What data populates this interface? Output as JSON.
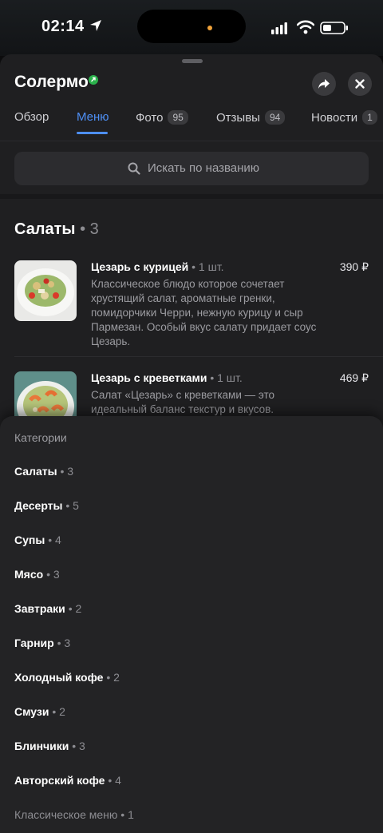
{
  "status_bar": {
    "time": "02:14"
  },
  "place": {
    "title": "Солермо",
    "verified_color": "#2bb24c",
    "accent_color": "#4e8ff5"
  },
  "tabs": [
    {
      "label": "Обзор",
      "badge": null
    },
    {
      "label": "Меню",
      "badge": null,
      "active": true
    },
    {
      "label": "Фото",
      "badge": "95"
    },
    {
      "label": "Отзывы",
      "badge": "94"
    },
    {
      "label": "Новости",
      "badge": "1"
    }
  ],
  "search": {
    "placeholder": "Искать по названию"
  },
  "section": {
    "title": "Салаты",
    "count": "• 3"
  },
  "menu_items": [
    {
      "name": "Цезарь с курицей",
      "qty": "• 1 шт.",
      "price": "390 ₽",
      "description": "Классическое блюдо которое сочетает хрустящий салат, ароматные гренки, помидорчики Черри, нежную курицу и сыр Пармезан. Особый вкус салату придает соус Цезарь."
    },
    {
      "name": "Цезарь с креветками",
      "qty": "• 1 шт.",
      "price": "469 ₽",
      "description": "Салат «Цезарь» с креветками — это идеальный баланс текстур и вкусов."
    }
  ],
  "categories": {
    "header": "Категории",
    "items": [
      {
        "label": "Салаты",
        "count": "• 3"
      },
      {
        "label": "Десерты",
        "count": "• 5"
      },
      {
        "label": "Супы",
        "count": "• 4"
      },
      {
        "label": "Мясо",
        "count": "• 3"
      },
      {
        "label": "Завтраки",
        "count": "• 2"
      },
      {
        "label": "Гарнир",
        "count": "• 3"
      },
      {
        "label": "Холодный кофе",
        "count": "• 2"
      },
      {
        "label": "Смузи",
        "count": "• 2"
      },
      {
        "label": "Блинчики",
        "count": "• 3"
      },
      {
        "label": "Авторский кофе",
        "count": "• 4"
      },
      {
        "label": "Классическое меню",
        "count": "• 1"
      }
    ]
  }
}
